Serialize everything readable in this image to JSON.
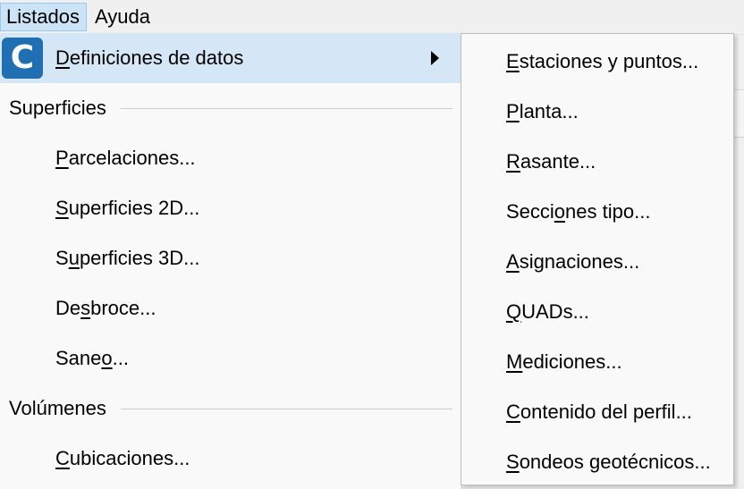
{
  "menubar": {
    "items": [
      {
        "label": "Listados",
        "mnemonic": "L"
      },
      {
        "label": "Ayuda",
        "mnemonic": "y"
      }
    ]
  },
  "main_menu": {
    "items": [
      {
        "kind": "item",
        "label": "Definiciones de datos",
        "mnemonic_index": 0,
        "icon": "app-logo-icon",
        "icon_glyph": "C",
        "has_submenu": true,
        "highlighted": true
      },
      {
        "kind": "section",
        "label": "Superficies"
      },
      {
        "kind": "item",
        "label": "Parcelaciones...",
        "mnemonic_index": 0
      },
      {
        "kind": "item",
        "label": "Superficies 2D...",
        "mnemonic_index": 0
      },
      {
        "kind": "item",
        "label": "Superficies 3D...",
        "mnemonic_index": 1
      },
      {
        "kind": "item",
        "label": "Desbroce...",
        "mnemonic_index": 2
      },
      {
        "kind": "item",
        "label": "Saneo...",
        "mnemonic_index": 4
      },
      {
        "kind": "section",
        "label": "Volúmenes"
      },
      {
        "kind": "item",
        "label": "Cubicaciones...",
        "mnemonic_index": 0
      }
    ]
  },
  "submenu": {
    "items": [
      {
        "label": "Estaciones y puntos...",
        "mnemonic_index": 0
      },
      {
        "label": "Planta...",
        "mnemonic_index": 0
      },
      {
        "label": "Rasante...",
        "mnemonic_index": 0
      },
      {
        "label": "Secciones tipo...",
        "mnemonic_index": 5
      },
      {
        "label": "Asignaciones...",
        "mnemonic_index": 0
      },
      {
        "label": "QUADs...",
        "mnemonic_index": 0
      },
      {
        "label": "Mediciones...",
        "mnemonic_index": 0
      },
      {
        "label": "Contenido del perfil...",
        "mnemonic_index": 0
      },
      {
        "label": "Sondeos geotécnicos...",
        "mnemonic_index": 0
      }
    ]
  },
  "colors": {
    "menu_background": "#f9f9f9",
    "highlight": "#d5e7f6",
    "menubar_active": "#cce4f7",
    "app_icon": "#1f6fb2"
  }
}
